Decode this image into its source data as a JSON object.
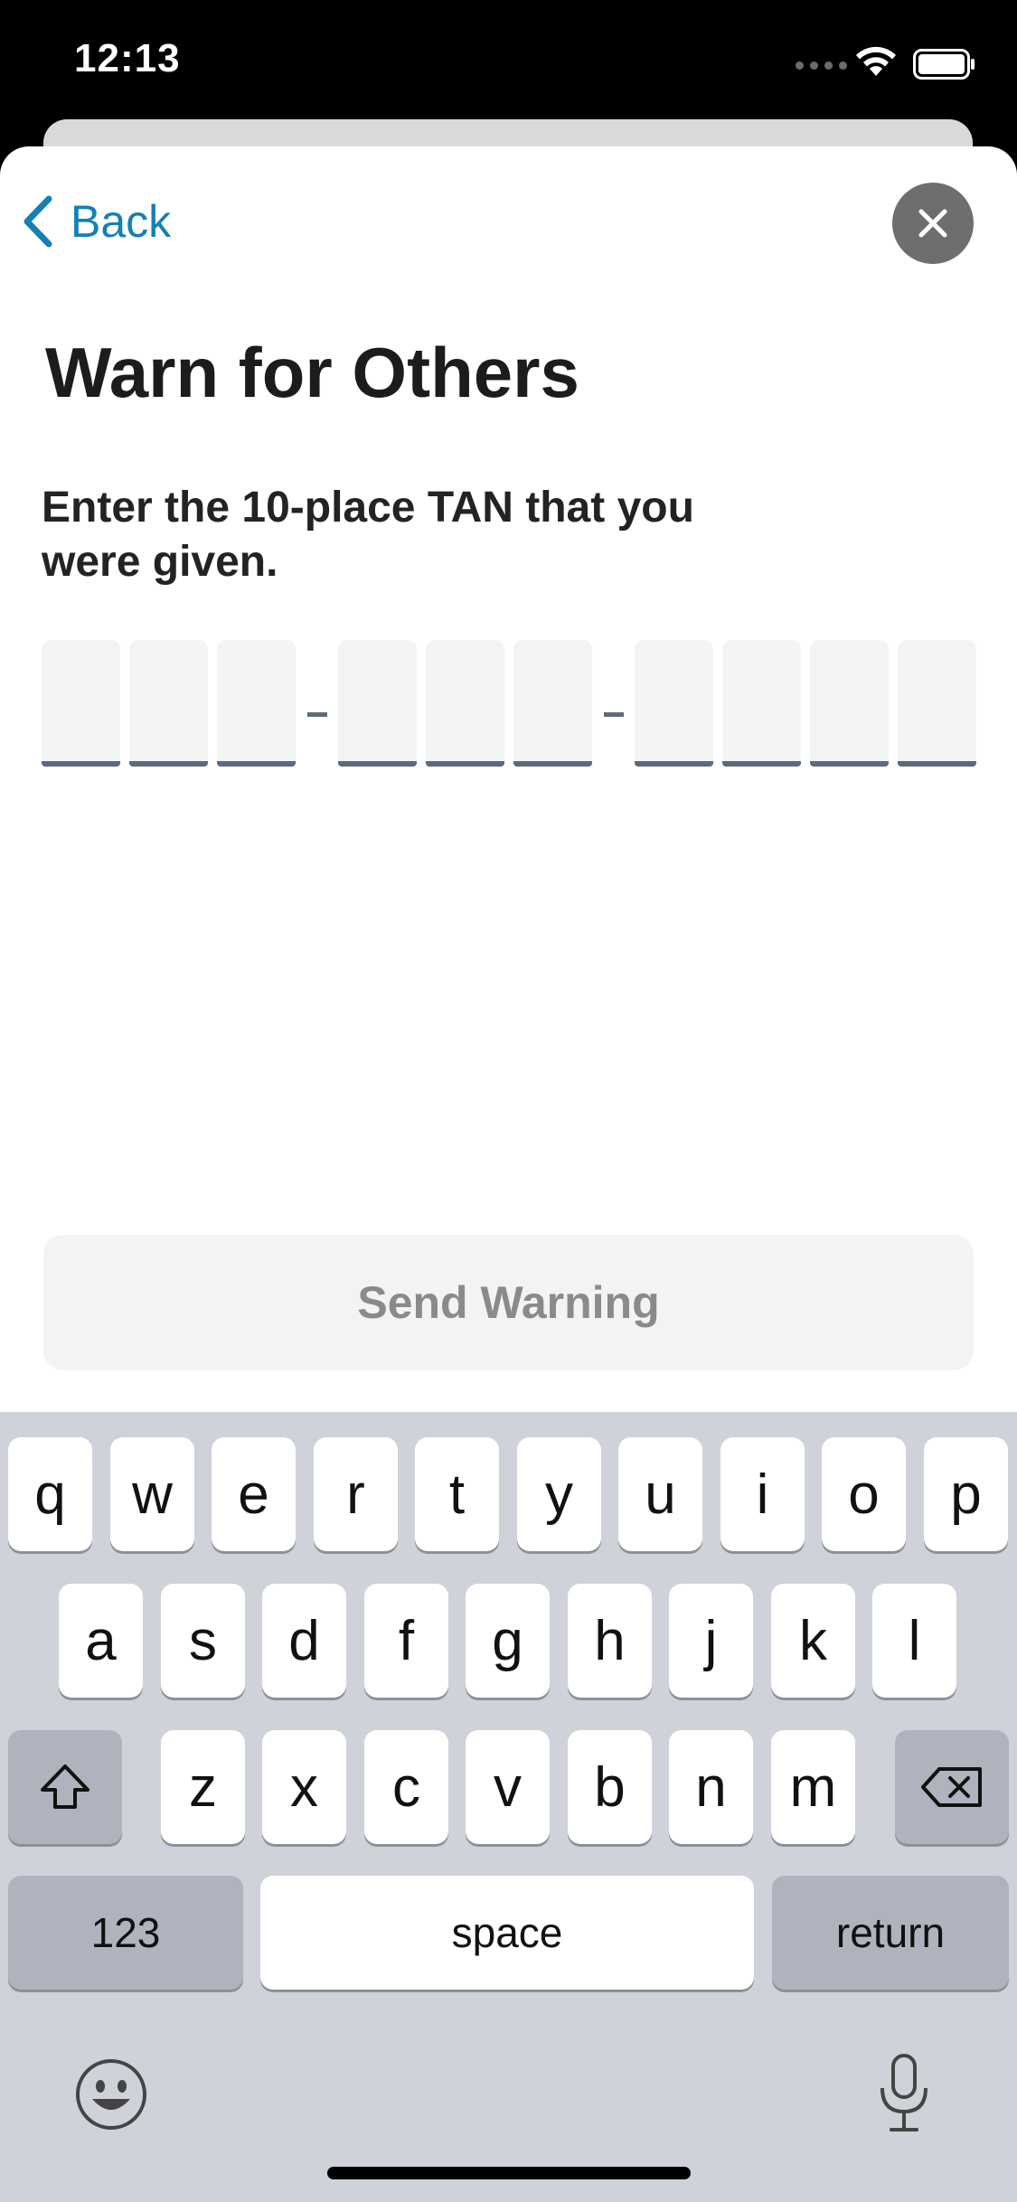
{
  "status_bar": {
    "time": "12:13"
  },
  "nav": {
    "back_label": "Back"
  },
  "page": {
    "title": "Warn for Others",
    "subtitle": "Enter the 10-place TAN that you were given."
  },
  "tan_input": {
    "length": 10,
    "groups": [
      3,
      3,
      4
    ],
    "values": [
      "",
      "",
      "",
      "",
      "",
      "",
      "",
      "",
      "",
      ""
    ]
  },
  "actions": {
    "send_label": "Send Warning",
    "send_enabled": false
  },
  "keyboard": {
    "row1": [
      "q",
      "w",
      "e",
      "r",
      "t",
      "y",
      "u",
      "i",
      "o",
      "p"
    ],
    "row2": [
      "a",
      "s",
      "d",
      "f",
      "g",
      "h",
      "j",
      "k",
      "l"
    ],
    "row3": [
      "z",
      "x",
      "c",
      "v",
      "b",
      "n",
      "m"
    ],
    "numbers_label": "123",
    "space_label": "space",
    "return_label": "return",
    "icons": [
      "shift-icon",
      "delete-icon",
      "emoji-icon",
      "microphone-icon"
    ]
  },
  "colors": {
    "accent": "#1380b6",
    "close_bg": "#6e6e6e",
    "tan_underline": "#5e6a7a",
    "send_disabled_bg": "#f3f3f3",
    "keyboard_bg": "#cfd2d8"
  }
}
